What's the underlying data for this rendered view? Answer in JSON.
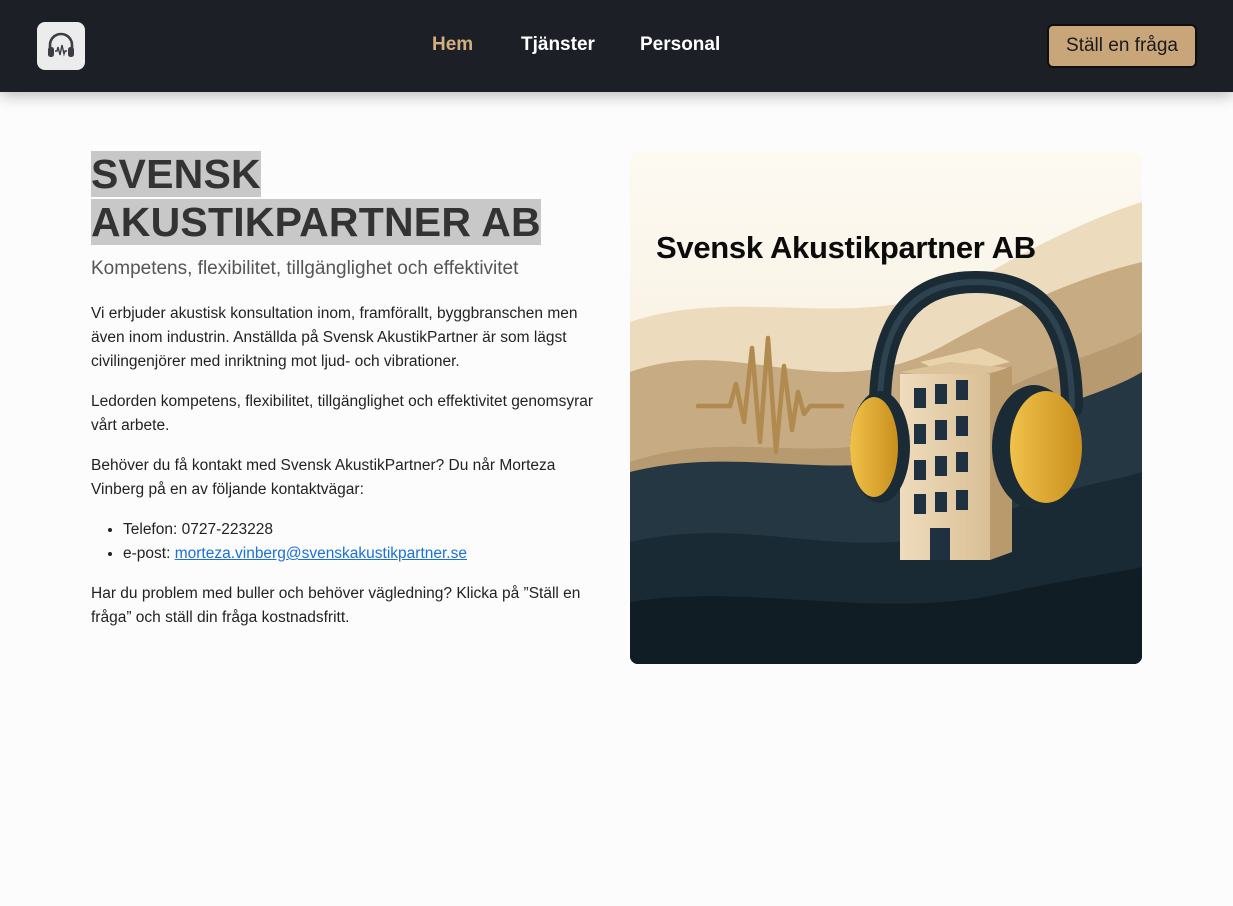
{
  "nav": {
    "logo_icon": "headphones-icon",
    "links": [
      {
        "label": "Hem",
        "active": true
      },
      {
        "label": "Tjänster",
        "active": false
      },
      {
        "label": "Personal",
        "active": false
      }
    ],
    "cta_label": "Ställ en fråga"
  },
  "main": {
    "title": "SVENSK AKUSTIKPARTNER AB",
    "subtitle": "Kompetens, flexibilitet, tillgänglighet och effektivitet",
    "paragraph1": "Vi erbjuder akustisk konsultation inom, framförallt, byggbranschen men även inom industrin. Anställda på Svensk AkustikPartner är som lägst civilingenjörer med inriktning mot ljud- och vibrationer.",
    "paragraph2": "Ledorden kompetens, flexibilitet, tillgänglighet och effektivitet genomsyrar vårt arbete.",
    "paragraph3": "Behöver du få kontakt med Svensk AkustikPartner? Du når Morteza Vinberg på en av följande kontaktvägar:",
    "phone_label": "Telefon: ",
    "phone": "0727-223228",
    "email_label": "e-post: ",
    "email": "morteza.vinberg@svenskakustikpartner.se",
    "paragraph4": "Har du problem med buller och behöver vägledning? Klicka på ”Ställ en fråga” och ställ din fråga kostnadsfritt."
  },
  "hero_image": {
    "title": "Svensk Akustikpartner AB"
  },
  "colors": {
    "navbar_bg": "#1c1f26",
    "accent": "#d5ae7f",
    "cta_bg": "#c9a57a",
    "link": "#1a6fd9"
  }
}
